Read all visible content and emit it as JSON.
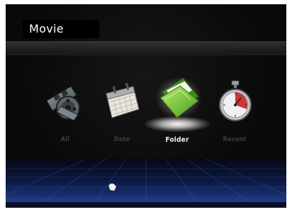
{
  "header": {
    "title": "Movie"
  },
  "categories": [
    {
      "label": "All",
      "icon": "film-reel-icon",
      "selected": false
    },
    {
      "label": "Date",
      "icon": "calendar-icon",
      "selected": false
    },
    {
      "label": "Folder",
      "icon": "folder-icon",
      "selected": true
    },
    {
      "label": "Recent",
      "icon": "stopwatch-icon",
      "selected": false
    }
  ],
  "colors": {
    "background": "#0b0b0b",
    "title_box": "#000000",
    "label_inactive": "#3e3e3e",
    "label_active": "#f0f0f0",
    "folder_green": "#6cc43a",
    "floor_blue": "#1a3478"
  }
}
